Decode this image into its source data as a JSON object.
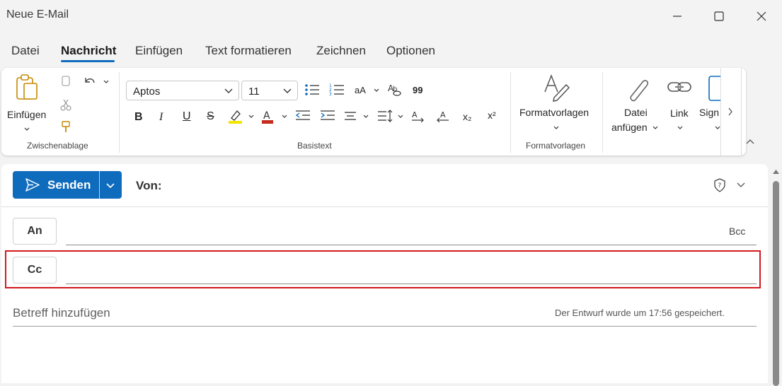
{
  "window": {
    "title": "Neue E-Mail"
  },
  "tabs": [
    {
      "label": "Datei"
    },
    {
      "label": "Nachricht"
    },
    {
      "label": "Einfügen"
    },
    {
      "label": "Text formatieren"
    },
    {
      "label": "Zeichnen"
    },
    {
      "label": "Optionen"
    }
  ],
  "ribbon": {
    "clipboard": {
      "paste_label": "Einfügen",
      "group_label": "Zwischenablage"
    },
    "basic_text": {
      "font_name": "Aptos",
      "font_size": "11",
      "group_label": "Basistext",
      "subscript_label": "x₂",
      "superscript_label": "x²",
      "change_case_label": "aA",
      "quote_label": "99"
    },
    "styles": {
      "styles_label": "Formatvorlagen",
      "group_label": "Formatvorlagen"
    },
    "include": {
      "attach_label_line1": "Datei",
      "attach_label_line2": "anfügen",
      "link_label": "Link",
      "signature_label": "Sign"
    }
  },
  "compose": {
    "send_label": "Senden",
    "from_label": "Von:",
    "to_label": "An",
    "bcc_label": "Bcc",
    "cc_label": "Cc",
    "subject_placeholder": "Betreff hinzufügen",
    "draft_status": "Der Entwurf wurde um 17:56 gespeichert."
  },
  "colors": {
    "accent": "#0f6cbd",
    "highlight_box": "#d2191e",
    "highlighter": "#f2e600",
    "font_color": "#c42b1c"
  }
}
